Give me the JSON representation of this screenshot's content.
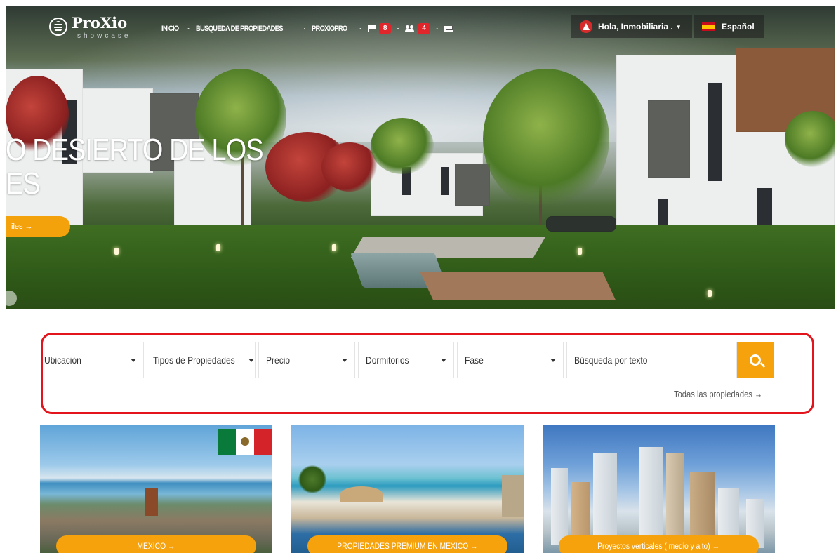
{
  "header": {
    "logo_text": "ProXio",
    "logo_subtitle": "showcase",
    "menu": [
      {
        "label": "INICIO"
      },
      {
        "label": "BUSQUEDA DE PROPIEDADES"
      },
      {
        "label": "PROXIOPRO"
      }
    ],
    "flag_badge": "8",
    "users_badge": "4",
    "user_greeting": "Hola, Inmobiliaria .",
    "language": "Español"
  },
  "hero": {
    "title_line1": "O DESIERTO DE LOS",
    "title_line2": "ES",
    "button_label": "iles →"
  },
  "search": {
    "filters": [
      {
        "label": "Ubicación"
      },
      {
        "label": "Tipos de Propiedades"
      },
      {
        "label": "Precio"
      },
      {
        "label": "Dormitorios"
      },
      {
        "label": "Fase"
      }
    ],
    "text_placeholder": "Búsqueda por texto",
    "all_properties_link": "Todas las propiedades →"
  },
  "cards": [
    {
      "label": "MEXICO  →"
    },
    {
      "label": "PROPIEDADES PREMIUM EN MEXICO  →"
    },
    {
      "label": "Proyectos verticales ( medio y alto)  →"
    }
  ],
  "colors": {
    "accent": "#f6a20c",
    "badge": "#e0252b",
    "highlight_outline": "#e3141b"
  },
  "icons": [
    "logo-icon",
    "flag-icon",
    "users-icon",
    "mail-icon",
    "user-avatar-icon",
    "spain-flag-icon",
    "search-icon",
    "mexico-flag-icon"
  ]
}
